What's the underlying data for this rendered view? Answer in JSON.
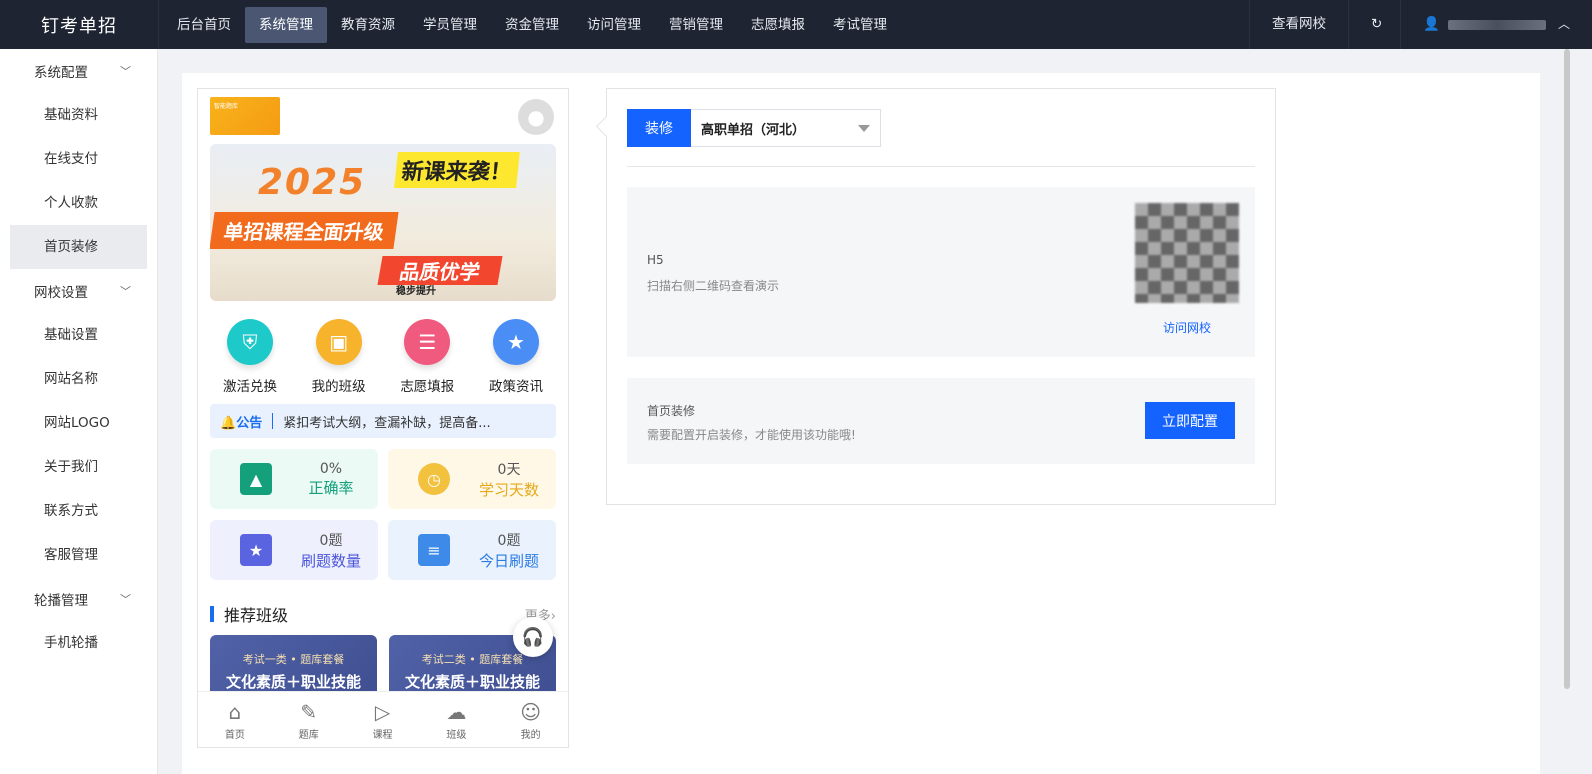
{
  "app": {
    "brand": "钉考单招"
  },
  "topnav": {
    "items": [
      {
        "label": "后台首页"
      },
      {
        "label": "系统管理"
      },
      {
        "label": "教育资源"
      },
      {
        "label": "学员管理"
      },
      {
        "label": "资金管理"
      },
      {
        "label": "访问管理"
      },
      {
        "label": "营销管理"
      },
      {
        "label": "志愿填报"
      },
      {
        "label": "考试管理"
      }
    ],
    "active_index": 1,
    "view_site": "查看网校",
    "refresh_icon": "refresh-icon",
    "user_icon": "user-icon"
  },
  "sidebar": {
    "groups": [
      {
        "label": "系统配置",
        "items": [
          "基础资料",
          "在线支付",
          "个人收款",
          "首页装修"
        ]
      },
      {
        "label": "网校设置",
        "items": [
          "基础设置",
          "网站名称",
          "网站LOGO",
          "关于我们",
          "联系方式",
          "客服管理"
        ]
      },
      {
        "label": "轮播管理",
        "items": [
          "手机轮播"
        ]
      }
    ],
    "active_item": "首页装修"
  },
  "phone": {
    "logo_text": "智能题库",
    "banner": {
      "year": "2025",
      "headline": "新课来袭！",
      "subline": "单招课程全面升级",
      "slogan": "品质优学",
      "slogan_sub": "稳步提升"
    },
    "icons": [
      {
        "label": "激活兑换",
        "icon": "shield-key-icon",
        "color": "#1ec9c9"
      },
      {
        "label": "我的班级",
        "icon": "class-badge-icon",
        "color": "#f7b32b"
      },
      {
        "label": "志愿填报",
        "icon": "form-icon",
        "color": "#f05a7e"
      },
      {
        "label": "政策资讯",
        "icon": "news-icon",
        "color": "#4a8df5"
      }
    ],
    "notice": {
      "tag": "公告",
      "text": "紧扣考试大纲，查漏补缺，提高备..."
    },
    "stats": [
      {
        "value": "0%",
        "label": "正确率",
        "color": "#13a07a",
        "bg": "#ecfaf6",
        "icon": "chart-up-icon"
      },
      {
        "value": "0天",
        "label": "学习天数",
        "color": "#e5a91a",
        "bg": "#fff8e6",
        "icon": "clock-icon"
      },
      {
        "value": "0题",
        "label": "刷题数量",
        "color": "#4b55d9",
        "bg": "#eef0fd",
        "icon": "star-icon"
      },
      {
        "value": "0题",
        "label": "今日刷题",
        "color": "#2c7be5",
        "bg": "#e9f2fd",
        "icon": "list-icon"
      }
    ],
    "recommend": {
      "title": "推荐班级",
      "more": "更多",
      "cards": [
        {
          "tag": "考试一类 • 题库套餐",
          "title": "文化素质＋职业技能"
        },
        {
          "tag": "考试二类 • 题库套餐",
          "title": "文化素质＋职业技能"
        }
      ]
    },
    "tabbar": [
      {
        "label": "首页",
        "icon": "home-icon"
      },
      {
        "label": "题库",
        "icon": "edit-icon"
      },
      {
        "label": "课程",
        "icon": "video-icon"
      },
      {
        "label": "班级",
        "icon": "group-icon"
      },
      {
        "label": "我的",
        "icon": "profile-icon"
      }
    ]
  },
  "panel": {
    "deco_button": "装修",
    "select_value": "高职单招（河北）",
    "h5": {
      "title": "H5",
      "desc": "扫描右侧二维码查看演示",
      "link": "访问网校"
    },
    "home_deco": {
      "title": "首页装修",
      "desc": "需要配置开启装修，才能使用该功能哦!",
      "button": "立即配置"
    }
  }
}
